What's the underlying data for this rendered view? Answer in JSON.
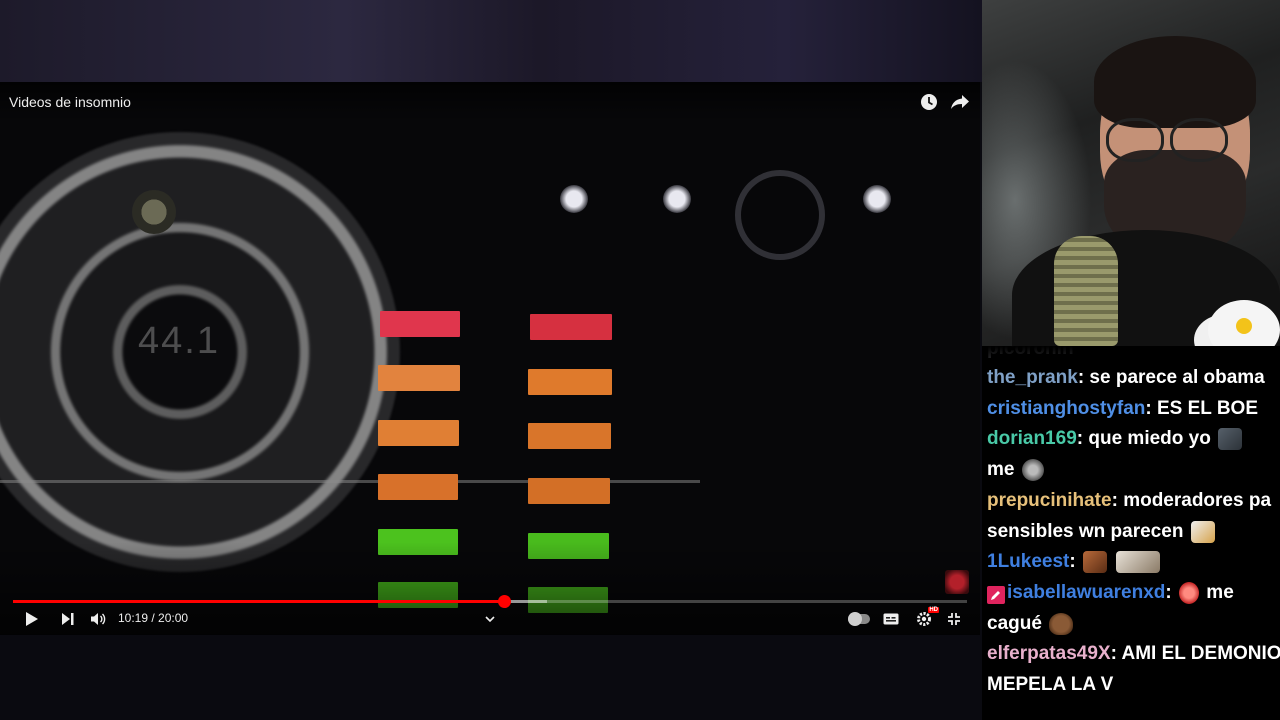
{
  "player": {
    "title": "Videos de insomnio",
    "time_display": "10:19 / 20:00",
    "progress_fraction": 0.515,
    "buffer_fraction": 0.56,
    "overlay_number": "44.1",
    "hd_badge": "HD",
    "colors": {
      "played": "#ff0000",
      "meter_red": "#e0364d",
      "meter_orange": "#e07a2e",
      "meter_green": "#4cc21e"
    },
    "icons": {
      "watch_later": "clock-icon",
      "share": "share-arrow-icon",
      "play": "play-icon",
      "next": "skip-next-icon",
      "volume": "volume-icon",
      "chapter": "chevron-down-icon",
      "autoplay": "autoplay-toggle-icon",
      "captions": "captions-icon",
      "settings": "gear-icon",
      "fullscreen": "exit-fullscreen-icon"
    }
  },
  "chat": {
    "partial_top": "picoronin",
    "messages": [
      {
        "user": "the_prank",
        "color": "#7fa0c6",
        "text": "se parece al obama"
      },
      {
        "user": "cristianghostyfan",
        "color": "#4f8fe6",
        "text": "ES EL BOE"
      },
      {
        "user": "dorian169",
        "color": "#49c9a7",
        "text": "que miedo yo",
        "text2": "me"
      },
      {
        "user": "prepucinihate",
        "color": "#e6c07a",
        "text": "moderadores pa sensibles wn parecen"
      },
      {
        "user": "1Lukeest",
        "color": "#3f7fe0",
        "text": ""
      },
      {
        "user": "isabellawuarenxd",
        "color": "#3f7fe0",
        "text": "me",
        "text2": "cagué"
      },
      {
        "user": "elferpatas49X",
        "color": "#e8b0cc",
        "text": "AMI EL DEMONIO MEPELA LA V"
      }
    ]
  }
}
